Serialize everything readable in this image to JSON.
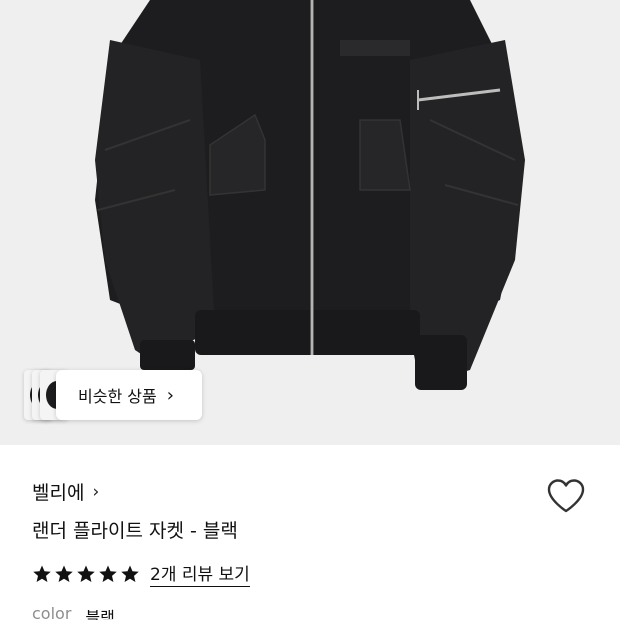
{
  "similar_products": {
    "label": "비슷한 상품",
    "chevron": "›"
  },
  "brand": {
    "name": "벨리에",
    "chevron": "›"
  },
  "product": {
    "title": "랜더 플라이트 자켓 - 블랙"
  },
  "rating": {
    "stars": 5,
    "max": 5,
    "review_link": "2개 리뷰 보기"
  },
  "option": {
    "label": "color",
    "value": "블랙"
  },
  "icons": {
    "wishlist": "heart-outline-icon",
    "star": "star-filled-icon"
  },
  "colors": {
    "image_bg": "#efefef",
    "jacket": "#1c1c1e",
    "text": "#111111",
    "muted": "#8e8e8e"
  }
}
